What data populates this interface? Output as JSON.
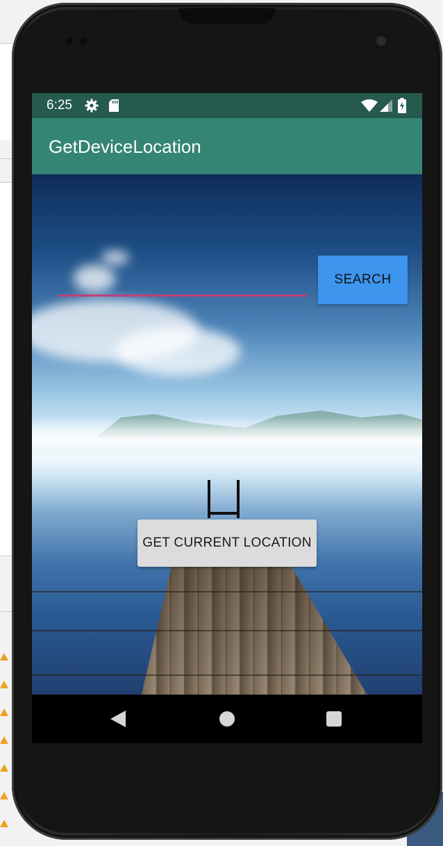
{
  "status_bar": {
    "time": "6:25",
    "icons": [
      "gear-icon",
      "sd-card-icon",
      "wifi-icon",
      "signal-icon",
      "battery-charging-icon"
    ]
  },
  "app_bar": {
    "title": "GetDeviceLocation"
  },
  "search": {
    "input_value": "",
    "button_label": "SEARCH"
  },
  "location": {
    "button_label": "GET CURRENT LOCATION"
  },
  "nav_bar": {
    "icons": [
      "back-icon",
      "home-icon",
      "recents-icon"
    ]
  },
  "colors": {
    "status_bar": "#265a4e",
    "app_bar": "#348574",
    "search_button": "#3d95ed",
    "input_underline": "#c33e7a",
    "location_button": "#dcdcdc"
  }
}
